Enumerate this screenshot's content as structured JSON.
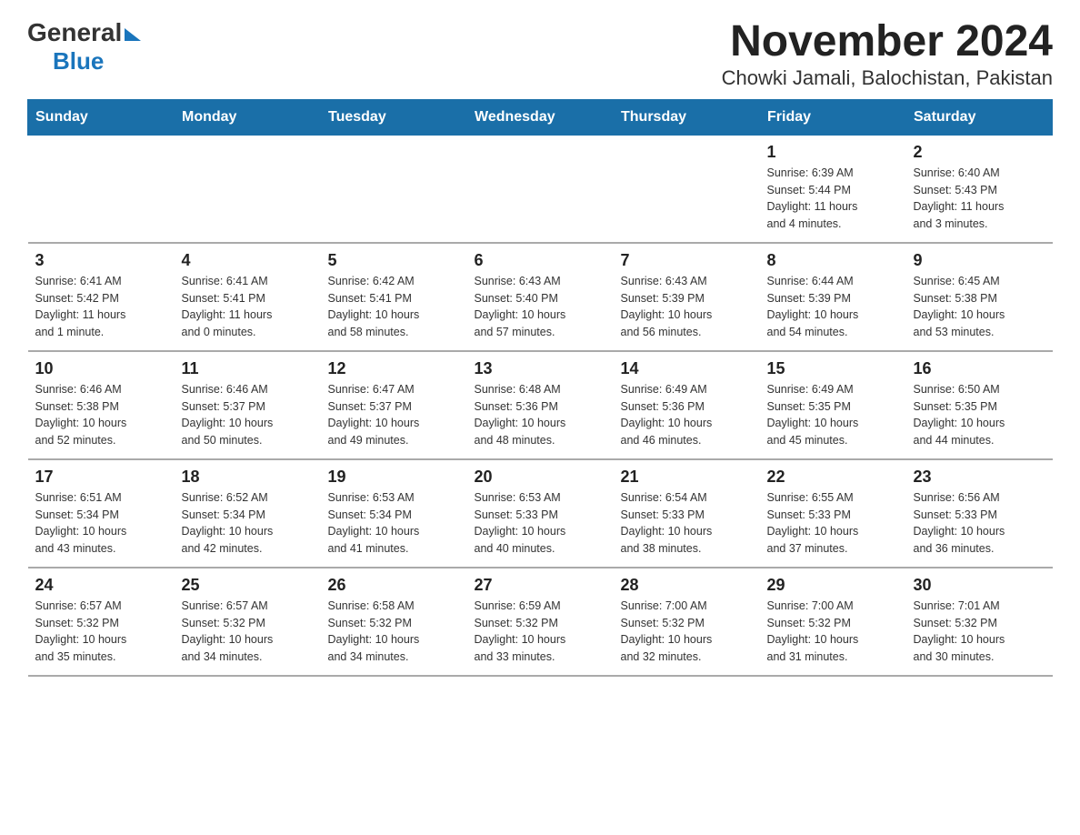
{
  "logo": {
    "general": "General",
    "blue": "Blue"
  },
  "title": "November 2024",
  "subtitle": "Chowki Jamali, Balochistan, Pakistan",
  "days_header": [
    "Sunday",
    "Monday",
    "Tuesday",
    "Wednesday",
    "Thursday",
    "Friday",
    "Saturday"
  ],
  "weeks": [
    [
      {
        "day": "",
        "info": ""
      },
      {
        "day": "",
        "info": ""
      },
      {
        "day": "",
        "info": ""
      },
      {
        "day": "",
        "info": ""
      },
      {
        "day": "",
        "info": ""
      },
      {
        "day": "1",
        "info": "Sunrise: 6:39 AM\nSunset: 5:44 PM\nDaylight: 11 hours\nand 4 minutes."
      },
      {
        "day": "2",
        "info": "Sunrise: 6:40 AM\nSunset: 5:43 PM\nDaylight: 11 hours\nand 3 minutes."
      }
    ],
    [
      {
        "day": "3",
        "info": "Sunrise: 6:41 AM\nSunset: 5:42 PM\nDaylight: 11 hours\nand 1 minute."
      },
      {
        "day": "4",
        "info": "Sunrise: 6:41 AM\nSunset: 5:41 PM\nDaylight: 11 hours\nand 0 minutes."
      },
      {
        "day": "5",
        "info": "Sunrise: 6:42 AM\nSunset: 5:41 PM\nDaylight: 10 hours\nand 58 minutes."
      },
      {
        "day": "6",
        "info": "Sunrise: 6:43 AM\nSunset: 5:40 PM\nDaylight: 10 hours\nand 57 minutes."
      },
      {
        "day": "7",
        "info": "Sunrise: 6:43 AM\nSunset: 5:39 PM\nDaylight: 10 hours\nand 56 minutes."
      },
      {
        "day": "8",
        "info": "Sunrise: 6:44 AM\nSunset: 5:39 PM\nDaylight: 10 hours\nand 54 minutes."
      },
      {
        "day": "9",
        "info": "Sunrise: 6:45 AM\nSunset: 5:38 PM\nDaylight: 10 hours\nand 53 minutes."
      }
    ],
    [
      {
        "day": "10",
        "info": "Sunrise: 6:46 AM\nSunset: 5:38 PM\nDaylight: 10 hours\nand 52 minutes."
      },
      {
        "day": "11",
        "info": "Sunrise: 6:46 AM\nSunset: 5:37 PM\nDaylight: 10 hours\nand 50 minutes."
      },
      {
        "day": "12",
        "info": "Sunrise: 6:47 AM\nSunset: 5:37 PM\nDaylight: 10 hours\nand 49 minutes."
      },
      {
        "day": "13",
        "info": "Sunrise: 6:48 AM\nSunset: 5:36 PM\nDaylight: 10 hours\nand 48 minutes."
      },
      {
        "day": "14",
        "info": "Sunrise: 6:49 AM\nSunset: 5:36 PM\nDaylight: 10 hours\nand 46 minutes."
      },
      {
        "day": "15",
        "info": "Sunrise: 6:49 AM\nSunset: 5:35 PM\nDaylight: 10 hours\nand 45 minutes."
      },
      {
        "day": "16",
        "info": "Sunrise: 6:50 AM\nSunset: 5:35 PM\nDaylight: 10 hours\nand 44 minutes."
      }
    ],
    [
      {
        "day": "17",
        "info": "Sunrise: 6:51 AM\nSunset: 5:34 PM\nDaylight: 10 hours\nand 43 minutes."
      },
      {
        "day": "18",
        "info": "Sunrise: 6:52 AM\nSunset: 5:34 PM\nDaylight: 10 hours\nand 42 minutes."
      },
      {
        "day": "19",
        "info": "Sunrise: 6:53 AM\nSunset: 5:34 PM\nDaylight: 10 hours\nand 41 minutes."
      },
      {
        "day": "20",
        "info": "Sunrise: 6:53 AM\nSunset: 5:33 PM\nDaylight: 10 hours\nand 40 minutes."
      },
      {
        "day": "21",
        "info": "Sunrise: 6:54 AM\nSunset: 5:33 PM\nDaylight: 10 hours\nand 38 minutes."
      },
      {
        "day": "22",
        "info": "Sunrise: 6:55 AM\nSunset: 5:33 PM\nDaylight: 10 hours\nand 37 minutes."
      },
      {
        "day": "23",
        "info": "Sunrise: 6:56 AM\nSunset: 5:33 PM\nDaylight: 10 hours\nand 36 minutes."
      }
    ],
    [
      {
        "day": "24",
        "info": "Sunrise: 6:57 AM\nSunset: 5:32 PM\nDaylight: 10 hours\nand 35 minutes."
      },
      {
        "day": "25",
        "info": "Sunrise: 6:57 AM\nSunset: 5:32 PM\nDaylight: 10 hours\nand 34 minutes."
      },
      {
        "day": "26",
        "info": "Sunrise: 6:58 AM\nSunset: 5:32 PM\nDaylight: 10 hours\nand 34 minutes."
      },
      {
        "day": "27",
        "info": "Sunrise: 6:59 AM\nSunset: 5:32 PM\nDaylight: 10 hours\nand 33 minutes."
      },
      {
        "day": "28",
        "info": "Sunrise: 7:00 AM\nSunset: 5:32 PM\nDaylight: 10 hours\nand 32 minutes."
      },
      {
        "day": "29",
        "info": "Sunrise: 7:00 AM\nSunset: 5:32 PM\nDaylight: 10 hours\nand 31 minutes."
      },
      {
        "day": "30",
        "info": "Sunrise: 7:01 AM\nSunset: 5:32 PM\nDaylight: 10 hours\nand 30 minutes."
      }
    ]
  ]
}
